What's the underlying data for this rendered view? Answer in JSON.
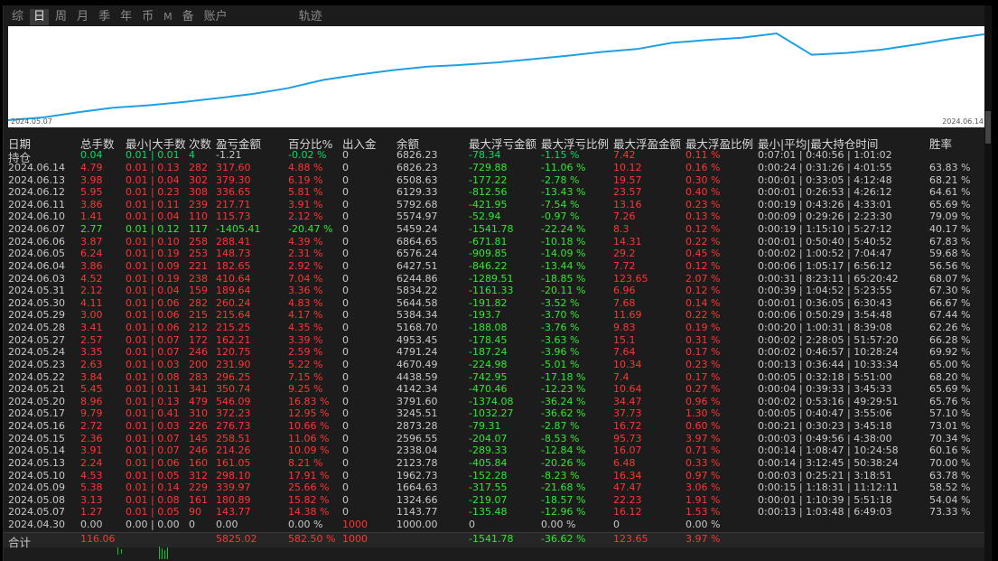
{
  "tabs": [
    "综",
    "日",
    "周",
    "月",
    "季",
    "年",
    "币",
    "M",
    "备",
    "账户",
    "轨迹"
  ],
  "active_tab": "日",
  "chart_data": {
    "type": "line",
    "x_start": "2024.05.07",
    "x_end": "2024.06.14",
    "color": "#1ea0e6",
    "x": [
      "2024.05.07",
      "2024.05.08",
      "2024.05.09",
      "2024.05.10",
      "2024.05.13",
      "2024.05.14",
      "2024.05.15",
      "2024.05.16",
      "2024.05.17",
      "2024.05.20",
      "2024.05.21",
      "2024.05.22",
      "2024.05.23",
      "2024.05.24",
      "2024.05.27",
      "2024.05.28",
      "2024.05.29",
      "2024.05.30",
      "2024.05.31",
      "2024.06.03",
      "2024.06.04",
      "2024.06.05",
      "2024.06.06",
      "2024.06.07",
      "2024.06.10",
      "2024.06.11",
      "2024.06.12",
      "2024.06.13",
      "2024.06.14"
    ],
    "values": [
      1143.77,
      1324.66,
      1664.63,
      1962.73,
      2123.78,
      2338.04,
      2596.55,
      2873.28,
      3245.51,
      3791.6,
      4142.34,
      4438.59,
      4670.49,
      4791.24,
      4953.45,
      5168.7,
      5384.34,
      5644.58,
      5834.22,
      6244.86,
      6427.51,
      6576.24,
      6864.65,
      5459.24,
      5574.97,
      5792.68,
      6129.33,
      6508.63,
      6826.23
    ]
  },
  "headers": [
    "日期",
    "总手数",
    "最小|大手数",
    "次数",
    "盈亏金额",
    "百分比%",
    "出入金",
    "余额",
    "最大浮亏金额",
    "最大浮亏比例",
    "最大浮盈金额",
    "最大浮盈比例",
    "最小|平均|最大持仓时间",
    "胜率"
  ],
  "open_row": {
    "date": "持仓",
    "lots": "0.04",
    "minmax": "0.01 | 0.01",
    "count": "4",
    "pnl": "-1.21",
    "pct": "-0.02 %",
    "io": "0",
    "bal": "6826.23",
    "ddamt": "-78.34",
    "ddpct": "-1.15 %",
    "fpamt": "7.42",
    "fppct": "0.11 %",
    "hold": "0:07:01 | 0:40:56 | 1:01:02",
    "win": ""
  },
  "rows": [
    {
      "date": "2024.06.14",
      "lots": "4.79",
      "minmax": "0.01 | 0.13",
      "count": "282",
      "pnl": "317.60",
      "pct": "4.88 %",
      "io": "0",
      "bal": "6826.23",
      "ddamt": "-729.88",
      "ddpct": "-11.06 %",
      "fpamt": "10.12",
      "fppct": "0.16 %",
      "hold": "0:00:24 | 0:31:26 | 4:01:55",
      "win": "63.83 %",
      "pos": true
    },
    {
      "date": "2024.06.13",
      "lots": "3.98",
      "minmax": "0.01 | 0.04",
      "count": "302",
      "pnl": "379.30",
      "pct": "6.19 %",
      "io": "0",
      "bal": "6508.63",
      "ddamt": "-177.22",
      "ddpct": "-2.78 %",
      "fpamt": "19.57",
      "fppct": "0.30 %",
      "hold": "0:00:01 | 0:33:05 | 4:12:48",
      "win": "68.21 %",
      "pos": true
    },
    {
      "date": "2024.06.12",
      "lots": "5.95",
      "minmax": "0.01 | 0.23",
      "count": "308",
      "pnl": "336.65",
      "pct": "5.81 %",
      "io": "0",
      "bal": "6129.33",
      "ddamt": "-812.56",
      "ddpct": "-13.43 %",
      "fpamt": "23.57",
      "fppct": "0.40 %",
      "hold": "0:00:01 | 0:26:53 | 4:26:12",
      "win": "64.61 %",
      "pos": true
    },
    {
      "date": "2024.06.11",
      "lots": "3.86",
      "minmax": "0.01 | 0.11",
      "count": "239",
      "pnl": "217.71",
      "pct": "3.91 %",
      "io": "0",
      "bal": "5792.68",
      "ddamt": "-421.95",
      "ddpct": "-7.54 %",
      "fpamt": "13.16",
      "fppct": "0.23 %",
      "hold": "0:00:19 | 0:43:26 | 4:33:01",
      "win": "65.69 %",
      "pos": true
    },
    {
      "date": "2024.06.10",
      "lots": "1.41",
      "minmax": "0.01 | 0.04",
      "count": "110",
      "pnl": "115.73",
      "pct": "2.12 %",
      "io": "0",
      "bal": "5574.97",
      "ddamt": "-52.94",
      "ddpct": "-0.97 %",
      "fpamt": "7.26",
      "fppct": "0.13 %",
      "hold": "0:00:09 | 0:29:26 | 2:23:30",
      "win": "79.09 %",
      "pos": true
    },
    {
      "date": "2024.06.07",
      "lots": "2.77",
      "minmax": "0.01 | 0.12",
      "count": "117",
      "pnl": "-1405.41",
      "pct": "-20.47 %",
      "io": "0",
      "bal": "5459.24",
      "ddamt": "-1541.78",
      "ddpct": "-22.24 %",
      "fpamt": "8.3",
      "fppct": "0.12 %",
      "hold": "0:00:19 | 1:15:10 | 5:27:12",
      "win": "40.17 %",
      "pos": false
    },
    {
      "date": "2024.06.06",
      "lots": "3.87",
      "minmax": "0.01 | 0.10",
      "count": "258",
      "pnl": "288.41",
      "pct": "4.39 %",
      "io": "0",
      "bal": "6864.65",
      "ddamt": "-671.81",
      "ddpct": "-10.18 %",
      "fpamt": "14.31",
      "fppct": "0.22 %",
      "hold": "0:00:01 | 0:50:40 | 5:40:52",
      "win": "67.83 %",
      "pos": true
    },
    {
      "date": "2024.06.05",
      "lots": "6.24",
      "minmax": "0.01 | 0.19",
      "count": "253",
      "pnl": "148.73",
      "pct": "2.31 %",
      "io": "0",
      "bal": "6576.24",
      "ddamt": "-909.85",
      "ddpct": "-14.09 %",
      "fpamt": "29.2",
      "fppct": "0.45 %",
      "hold": "0:00:02 | 1:00:52 | 7:04:47",
      "win": "59.68 %",
      "pos": true
    },
    {
      "date": "2024.06.04",
      "lots": "3.86",
      "minmax": "0.01 | 0.09",
      "count": "221",
      "pnl": "182.65",
      "pct": "2.92 %",
      "io": "0",
      "bal": "6427.51",
      "ddamt": "-846.22",
      "ddpct": "-13.44 %",
      "fpamt": "7.72",
      "fppct": "0.12 %",
      "hold": "0:00:06 | 1:05:17 | 6:56:12",
      "win": "56.56 %",
      "pos": true
    },
    {
      "date": "2024.06.03",
      "lots": "4.52",
      "minmax": "0.01 | 0.19",
      "count": "238",
      "pnl": "410.64",
      "pct": "7.04 %",
      "io": "0",
      "bal": "6244.86",
      "ddamt": "-1289.51",
      "ddpct": "-18.85 %",
      "fpamt": "123.65",
      "fppct": "2.07 %",
      "hold": "0:00:31 | 8:23:11 | 65:20:42",
      "win": "68.07 %",
      "pos": true
    },
    {
      "date": "2024.05.31",
      "lots": "2.12",
      "minmax": "0.01 | 0.04",
      "count": "159",
      "pnl": "189.64",
      "pct": "3.36 %",
      "io": "0",
      "bal": "5834.22",
      "ddamt": "-1161.33",
      "ddpct": "-20.11 %",
      "fpamt": "6.96",
      "fppct": "0.12 %",
      "hold": "0:00:39 | 1:04:52 | 5:23:55",
      "win": "67.30 %",
      "pos": true
    },
    {
      "date": "2024.05.30",
      "lots": "4.11",
      "minmax": "0.01 | 0.06",
      "count": "282",
      "pnl": "260.24",
      "pct": "4.83 %",
      "io": "0",
      "bal": "5644.58",
      "ddamt": "-191.82",
      "ddpct": "-3.52 %",
      "fpamt": "7.68",
      "fppct": "0.14 %",
      "hold": "0:00:01 | 0:36:05 | 6:30:43",
      "win": "66.67 %",
      "pos": true
    },
    {
      "date": "2024.05.29",
      "lots": "3.00",
      "minmax": "0.01 | 0.06",
      "count": "215",
      "pnl": "215.64",
      "pct": "4.17 %",
      "io": "0",
      "bal": "5384.34",
      "ddamt": "-193.7",
      "ddpct": "-3.70 %",
      "fpamt": "11.69",
      "fppct": "0.22 %",
      "hold": "0:00:06 | 0:50:29 | 3:54:48",
      "win": "67.44 %",
      "pos": true
    },
    {
      "date": "2024.05.28",
      "lots": "3.41",
      "minmax": "0.01 | 0.06",
      "count": "212",
      "pnl": "215.25",
      "pct": "4.35 %",
      "io": "0",
      "bal": "5168.70",
      "ddamt": "-188.08",
      "ddpct": "-3.76 %",
      "fpamt": "9.83",
      "fppct": "0.19 %",
      "hold": "0:00:20 | 1:00:31 | 8:39:08",
      "win": "62.26 %",
      "pos": true
    },
    {
      "date": "2024.05.27",
      "lots": "2.57",
      "minmax": "0.01 | 0.07",
      "count": "172",
      "pnl": "162.21",
      "pct": "3.39 %",
      "io": "0",
      "bal": "4953.45",
      "ddamt": "-178.45",
      "ddpct": "-3.63 %",
      "fpamt": "15.1",
      "fppct": "0.31 %",
      "hold": "0:00:02 | 2:28:05 | 51:57:20",
      "win": "66.28 %",
      "pos": true
    },
    {
      "date": "2024.05.24",
      "lots": "3.35",
      "minmax": "0.01 | 0.07",
      "count": "246",
      "pnl": "120.75",
      "pct": "2.59 %",
      "io": "0",
      "bal": "4791.24",
      "ddamt": "-187.24",
      "ddpct": "-3.96 %",
      "fpamt": "7.64",
      "fppct": "0.17 %",
      "hold": "0:00:02 | 0:46:57 | 10:28:24",
      "win": "69.92 %",
      "pos": true
    },
    {
      "date": "2024.05.23",
      "lots": "2.63",
      "minmax": "0.01 | 0.03",
      "count": "200",
      "pnl": "231.90",
      "pct": "5.22 %",
      "io": "0",
      "bal": "4670.49",
      "ddamt": "-224.98",
      "ddpct": "-5.01 %",
      "fpamt": "10.34",
      "fppct": "0.23 %",
      "hold": "0:00:13 | 0:36:44 | 10:33:34",
      "win": "65.00 %",
      "pos": true
    },
    {
      "date": "2024.05.22",
      "lots": "3.84",
      "minmax": "0.01 | 0.08",
      "count": "283",
      "pnl": "296.25",
      "pct": "7.15 %",
      "io": "0",
      "bal": "4438.59",
      "ddamt": "-742.95",
      "ddpct": "-17.18 %",
      "fpamt": "7.4",
      "fppct": "0.17 %",
      "hold": "0:00:05 | 0:32:18 | 5:51:00",
      "win": "68.20 %",
      "pos": true
    },
    {
      "date": "2024.05.21",
      "lots": "5.45",
      "minmax": "0.01 | 0.11",
      "count": "341",
      "pnl": "350.74",
      "pct": "9.25 %",
      "io": "0",
      "bal": "4142.34",
      "ddamt": "-470.46",
      "ddpct": "-12.23 %",
      "fpamt": "10.64",
      "fppct": "0.27 %",
      "hold": "0:00:04 | 0:39:33 | 3:45:33",
      "win": "65.69 %",
      "pos": true
    },
    {
      "date": "2024.05.20",
      "lots": "8.96",
      "minmax": "0.01 | 0.13",
      "count": "479",
      "pnl": "546.09",
      "pct": "16.83 %",
      "io": "0",
      "bal": "3791.60",
      "ddamt": "-1374.08",
      "ddpct": "-36.24 %",
      "fpamt": "34.47",
      "fppct": "0.96 %",
      "hold": "0:00:02 | 0:53:16 | 49:29:51",
      "win": "65.76 %",
      "pos": true
    },
    {
      "date": "2024.05.17",
      "lots": "9.79",
      "minmax": "0.01 | 0.41",
      "count": "310",
      "pnl": "372.23",
      "pct": "12.95 %",
      "io": "0",
      "bal": "3245.51",
      "ddamt": "-1032.27",
      "ddpct": "-36.62 %",
      "fpamt": "37.73",
      "fppct": "1.30 %",
      "hold": "0:00:05 | 0:40:47 | 3:55:06",
      "win": "57.10 %",
      "pos": true
    },
    {
      "date": "2024.05.16",
      "lots": "2.72",
      "minmax": "0.01 | 0.03",
      "count": "226",
      "pnl": "276.73",
      "pct": "10.66 %",
      "io": "0",
      "bal": "2873.28",
      "ddamt": "-79.31",
      "ddpct": "-2.87 %",
      "fpamt": "16.72",
      "fppct": "0.60 %",
      "hold": "0:00:21 | 0:30:23 | 3:45:18",
      "win": "73.01 %",
      "pos": true
    },
    {
      "date": "2024.05.15",
      "lots": "2.36",
      "minmax": "0.01 | 0.07",
      "count": "145",
      "pnl": "258.51",
      "pct": "11.06 %",
      "io": "0",
      "bal": "2596.55",
      "ddamt": "-204.07",
      "ddpct": "-8.53 %",
      "fpamt": "95.73",
      "fppct": "3.97 %",
      "hold": "0:00:03 | 0:49:56 | 4:38:00",
      "win": "70.34 %",
      "pos": true
    },
    {
      "date": "2024.05.14",
      "lots": "3.91",
      "minmax": "0.01 | 0.07",
      "count": "246",
      "pnl": "214.26",
      "pct": "10.09 %",
      "io": "0",
      "bal": "2338.04",
      "ddamt": "-289.33",
      "ddpct": "-12.84 %",
      "fpamt": "16.07",
      "fppct": "0.71 %",
      "hold": "0:00:14 | 1:08:47 | 10:24:58",
      "win": "60.16 %",
      "pos": true
    },
    {
      "date": "2024.05.13",
      "lots": "2.24",
      "minmax": "0.01 | 0.06",
      "count": "160",
      "pnl": "161.05",
      "pct": "8.21 %",
      "io": "0",
      "bal": "2123.78",
      "ddamt": "-405.84",
      "ddpct": "-20.26 %",
      "fpamt": "6.48",
      "fppct": "0.33 %",
      "hold": "0:00:14 | 3:12:45 | 50:38:24",
      "win": "70.00 %",
      "pos": true
    },
    {
      "date": "2024.05.10",
      "lots": "4.53",
      "minmax": "0.01 | 0.05",
      "count": "312",
      "pnl": "298.10",
      "pct": "17.91 %",
      "io": "0",
      "bal": "1962.73",
      "ddamt": "-152.28",
      "ddpct": "-8.23 %",
      "fpamt": "16.34",
      "fppct": "0.97 %",
      "hold": "0:00:03 | 0:25:21 | 3:18:51",
      "win": "63.78 %",
      "pos": true
    },
    {
      "date": "2024.05.09",
      "lots": "5.38",
      "minmax": "0.01 | 0.14",
      "count": "229",
      "pnl": "339.97",
      "pct": "25.66 %",
      "io": "0",
      "bal": "1664.63",
      "ddamt": "-317.55",
      "ddpct": "-21.68 %",
      "fpamt": "47.47",
      "fppct": "3.06 %",
      "hold": "0:00:15 | 1:18:31 | 11:12:11",
      "win": "58.52 %",
      "pos": true
    },
    {
      "date": "2024.05.08",
      "lots": "3.13",
      "minmax": "0.01 | 0.08",
      "count": "161",
      "pnl": "180.89",
      "pct": "15.82 %",
      "io": "0",
      "bal": "1324.66",
      "ddamt": "-219.07",
      "ddpct": "-18.57 %",
      "fpamt": "22.23",
      "fppct": "1.91 %",
      "hold": "0:00:01 | 1:10:39 | 5:51:18",
      "win": "54.04 %",
      "pos": true
    },
    {
      "date": "2024.05.07",
      "lots": "1.27",
      "minmax": "0.01 | 0.05",
      "count": "90",
      "pnl": "143.77",
      "pct": "14.38 %",
      "io": "0",
      "bal": "1143.77",
      "ddamt": "-135.48",
      "ddpct": "-12.96 %",
      "fpamt": "16.12",
      "fppct": "1.53 %",
      "hold": "0:00:13 | 1:03:48 | 6:49:03",
      "win": "73.33 %",
      "pos": true
    }
  ],
  "init_row": {
    "date": "2024.04.30",
    "lots": "0.00",
    "minmax": "0.00 | 0.00",
    "count": "0",
    "pnl": "0.00",
    "pct": "0.00 %",
    "io": "1000",
    "bal": "1000.00",
    "ddamt": "0",
    "ddpct": "0.00 %",
    "fpamt": "0",
    "fppct": "0.00 %"
  },
  "total_row": {
    "date": "合计",
    "lots": "116.06",
    "pnl": "5825.02",
    "pct": "582.50 %",
    "io": "1000",
    "ddamt": "-1541.78",
    "ddpct": "-36.62 %",
    "fpamt": "123.65",
    "fppct": "3.97 %"
  }
}
